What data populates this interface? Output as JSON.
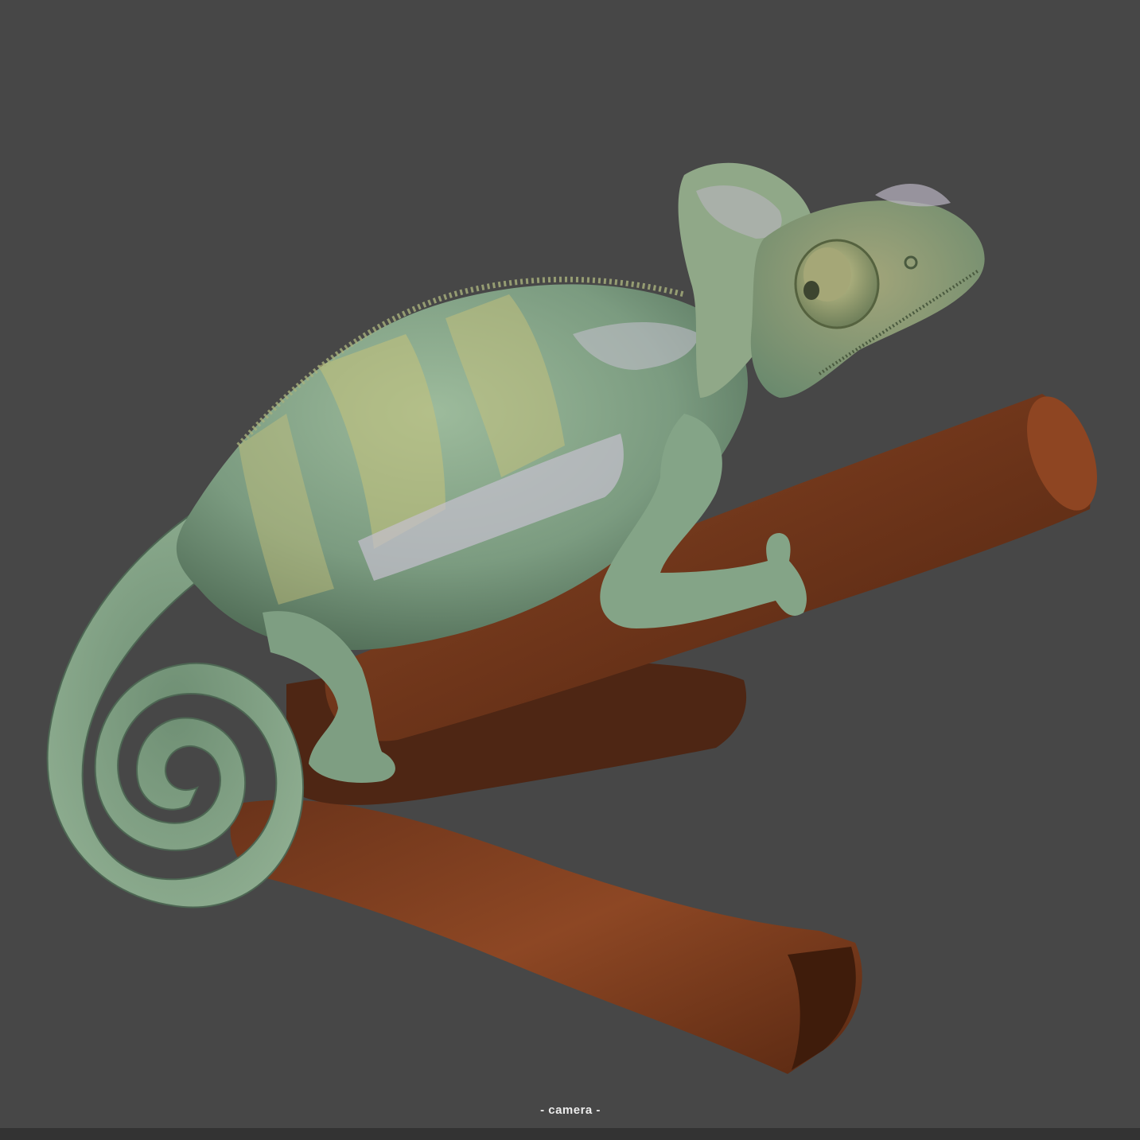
{
  "viewport": {
    "camera_label": "- camera -",
    "background_color": "#474747",
    "bottom_bar_color": "#333333"
  },
  "model": {
    "subject": "chameleon",
    "body_color": "#7fa083",
    "stripe_yellow": "#c7c27a",
    "stripe_lavender": "#bdb6c4",
    "branch_color": "#7a3e1f"
  }
}
